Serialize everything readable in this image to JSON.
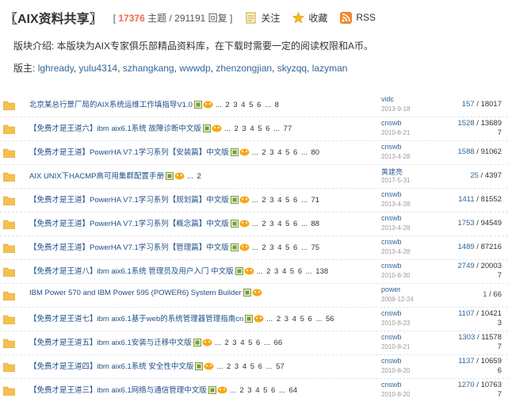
{
  "forum": {
    "title": "〖AIX资料共享〗",
    "stats_open": "[",
    "topic_count": "17376",
    "topic_label": "主题",
    "stats_sep": "/",
    "post_count": "291191",
    "post_label": "回复",
    "stats_close": "]"
  },
  "links": {
    "follow": "关注",
    "favorite": "收藏",
    "rss": "RSS"
  },
  "description": "版块介绍: 本版块为AIX专家俱乐部精品资料库，在下载时需要一定的阅读权限和A币。",
  "moderators": {
    "label": "版主:",
    "names": [
      "lghready",
      "yulu4314",
      "szhangkang",
      "wwwdp",
      "zhenzongjian",
      "skyzqq",
      "lazyman"
    ]
  },
  "threads": [
    {
      "title": "北京某总行景厂局的AIX系统运维工作填指导V1.0",
      "pages": "... 2 3 4 5 6 ... 8",
      "author": "vidc",
      "date": "2013-9-18",
      "replies": "157",
      "views": "18017"
    },
    {
      "title": "【免费才是王道六】ibm aix6.1系统 故障诊断中文版",
      "pages": "... 2 3 4 5 6 ... 77",
      "author": "cnswb",
      "date": "2010-8-21",
      "replies": "1528",
      "views": "13689",
      "views_wrap": "7"
    },
    {
      "title": "【免费才是王道】PowerHA V7.1学习系列【安装篇】中文版",
      "pages": "... 2 3 4 5 6 ... 80",
      "author": "cnswb",
      "date": "2013-4-28",
      "replies": "1588",
      "views": "91062"
    },
    {
      "title": "AIX UNIX下HACMP高可用集群配置手册",
      "pages": "... 2",
      "author": "黄建亮",
      "date": "2017-5-31",
      "replies": "25",
      "views": "4397"
    },
    {
      "title": "【免费才是王道】PowerHA V7.1学习系列【规划篇】中文版",
      "pages": "... 2 3 4 5 6 ... 71",
      "author": "cnswb",
      "date": "2013-4-28",
      "replies": "1411",
      "views": "81552"
    },
    {
      "title": "【免费才是王道】PowerHA V7.1学习系列【概念篇】中文版",
      "pages": "... 2 3 4 5 6 ... 88",
      "author": "cnswb",
      "date": "2013-4-28",
      "replies": "1753",
      "views": "94549"
    },
    {
      "title": "【免费才是王道】PowerHA V7.1学习系列【管理篇】中文版",
      "pages": "... 2 3 4 5 6 ... 75",
      "author": "cnswb",
      "date": "2013-4-28",
      "replies": "1489",
      "views": "87216"
    },
    {
      "title": "【免费才是王道八】ibm aix6.1系统 管理员及用户入门 中文版",
      "pages": "... 2 3 4 5 6 ... 138",
      "author": "cnswb",
      "date": "2010-8-30",
      "replies": "2749",
      "views": "20003",
      "views_wrap": "7"
    },
    {
      "title": "IBM Power 570 and IBM Power 595 (POWER6) System Builder",
      "pages": "",
      "author": "power",
      "date": "2008-12-24",
      "replies": "1",
      "views": "66"
    },
    {
      "title": "【免费才是王道七】ibm aix6.1基于web的系统管理器管理指南cn",
      "pages": "... 2 3 4 5 6 ... 56",
      "author": "cnswb",
      "date": "2010-8-23",
      "replies": "1107",
      "views": "10421",
      "views_wrap": "3"
    },
    {
      "title": "【免费才是王道五】ibm aix6.1安装与迁移中文版",
      "pages": "... 2 3 4 5 6 ... 66",
      "author": "cnswb",
      "date": "2010-8-21",
      "replies": "1303",
      "views": "11578",
      "views_wrap": "7"
    },
    {
      "title": "【免费才是王道四】ibm aix6.1系统 安全性中文版",
      "pages": "... 2 3 4 5 6 ... 57",
      "author": "cnswb",
      "date": "2010-8-20",
      "replies": "1137",
      "views": "10659",
      "views_wrap": "6"
    },
    {
      "title": "【免费才是王道三】ibm aix6.1网络与通信管理中文版",
      "pages": "... 2 3 4 5 6 ... 64",
      "author": "cnswb",
      "date": "2010-8-20",
      "replies": "1270",
      "views": "10763",
      "views_wrap": "7"
    }
  ],
  "colors": {
    "accent": "#f26c4f",
    "link": "#336699",
    "folder": "#f3c14f",
    "attachment_icon": "#7a9a3c",
    "reward_icon": "#f6a91b"
  },
  "icons": {
    "follow": "bookmark-icon",
    "favorite": "star-icon",
    "rss": "rss-icon",
    "thread": "folder-icon",
    "attachment": "attachment-icon",
    "reward": "reward-icon"
  }
}
